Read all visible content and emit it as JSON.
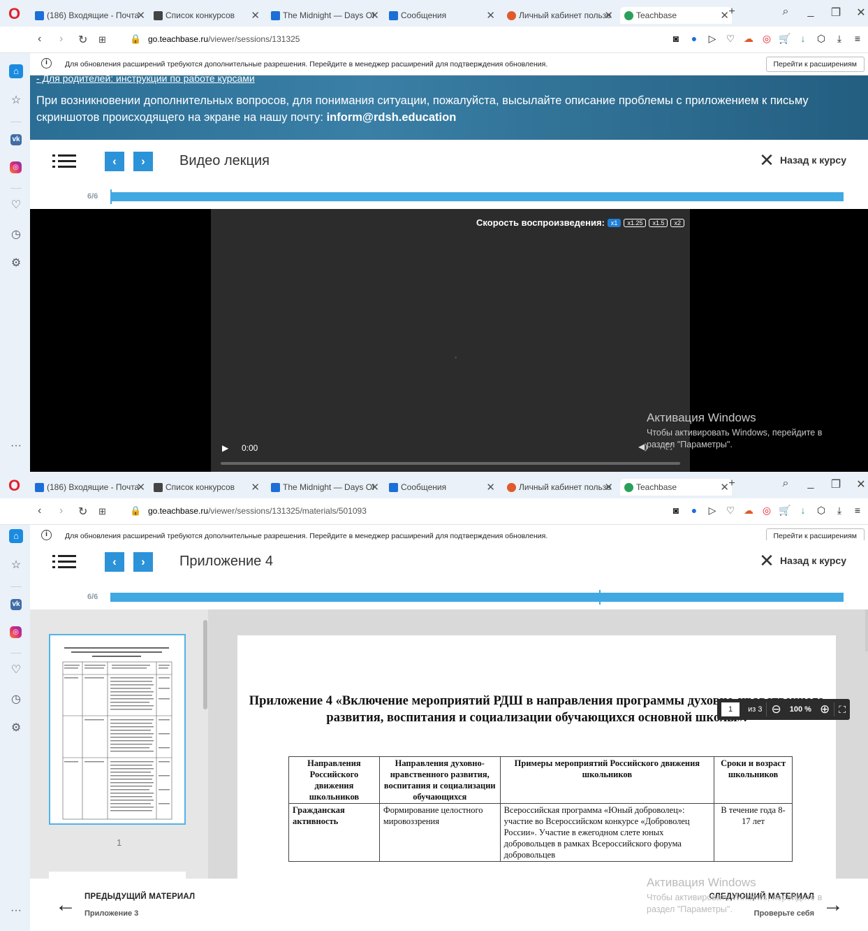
{
  "screens": [
    {
      "tabs": [
        {
          "label": "(186) Входящие - Почта",
          "favicon_color": "#1b6fd6"
        },
        {
          "label": "Список конкурсов",
          "favicon_color": "#444444"
        },
        {
          "label": "The Midnight — Days Of",
          "favicon_color": "#1b6fd6"
        },
        {
          "label": "Сообщения",
          "favicon_color": "#1b6fd6"
        },
        {
          "label": "Личный кабинет пользо",
          "favicon_color": "#e05a2a"
        },
        {
          "label": "Teachbase",
          "favicon_color": "#2aa05a",
          "active": true
        }
      ],
      "url_host": "go.teachbase.ru",
      "url_path": "/viewer/sessions/131325",
      "notification": "Для обновления расширений требуются дополнительные разрешения. Перейдите в менеджер расширений для подтверждения обновления.",
      "notification_button": "Перейти к расширениям",
      "banner_cut_link": "- Для родителей: инструкции по работе курсами",
      "banner_text": "При возникновении дополнительных вопросов, для понимания ситуации, пожалуйста, высылайте описание проблемы с приложением к письму скриншотов происходящего на экране на нашу почту:",
      "banner_email": "inform@rdsh.education",
      "header_title": "Видео лекция",
      "back_label": "Назад к курсу",
      "progress_label": "6/6",
      "progress_fraction": 1.0,
      "speed_label": "Скорость воспроизведения:",
      "speeds": [
        "x1",
        "x1.25",
        "x1.5",
        "x2"
      ],
      "play_icon": "▶",
      "time": "0:00",
      "watermark_title": "Активация Windows",
      "watermark_line1": "Чтобы активировать Windows, перейдите в",
      "watermark_line2": "раздел \"Параметры\"."
    },
    {
      "tabs": [
        {
          "label": "(186) Входящие - Почта",
          "favicon_color": "#1b6fd6"
        },
        {
          "label": "Список конкурсов",
          "favicon_color": "#444444"
        },
        {
          "label": "The Midnight — Days Of",
          "favicon_color": "#1b6fd6"
        },
        {
          "label": "Сообщения",
          "favicon_color": "#1b6fd6"
        },
        {
          "label": "Личный кабинет пользо",
          "favicon_color": "#e05a2a"
        },
        {
          "label": "Teachbase",
          "favicon_color": "#2aa05a",
          "active": true
        }
      ],
      "url_host": "go.teachbase.ru",
      "url_path": "/viewer/sessions/131325/materials/501093",
      "notification": "Для обновления расширений требуются дополнительные разрешения. Перейдите в менеджер расширений для подтверждения обновления.",
      "notification_button": "Перейти к расширениям",
      "header_title": "Приложение 4",
      "back_label": "Назад к курсу",
      "progress_label": "6/6",
      "progress_fraction": 1.0,
      "thumb_page": "1",
      "doc_title": "Приложение 4 «Включение мероприятий РДШ в направления программы духовно-нравственного развития, воспитания и социализации обучающихся основной школы».",
      "table_headers": [
        "Направления Российского движения школьников",
        "Направления духовно-нравственного развития, воспитания и социализации обучающихся",
        "Примеры мероприятий Российского движения школьников",
        "Сроки и возраст школьников"
      ],
      "table_row1": [
        "Гражданская активность",
        "Формирование целостного мировоззрения",
        "Всероссийская программа «Юный доброволец»: участие во Всероссийском конкурсе «Доброволец России». Участие в ежегодном слете юных добровольцев в рамках Всероссийского форума добровольцев",
        "В течение года 8-17 лет"
      ],
      "page_input": "1",
      "page_of": "из 3",
      "zoom_level": "100 %",
      "prev_label": "ПРЕДЫДУЩИЙ МАТЕРИАЛ",
      "prev_sub": "Приложение 3",
      "next_label": "СЛЕДУЮЩИЙ МАТЕРИАЛ",
      "next_sub": "Проверьте себя",
      "watermark_title": "Активация Windows",
      "watermark_line1": "Чтобы активировать Windows, перейдите в",
      "watermark_line2": "раздел \"Параметры\"."
    }
  ]
}
